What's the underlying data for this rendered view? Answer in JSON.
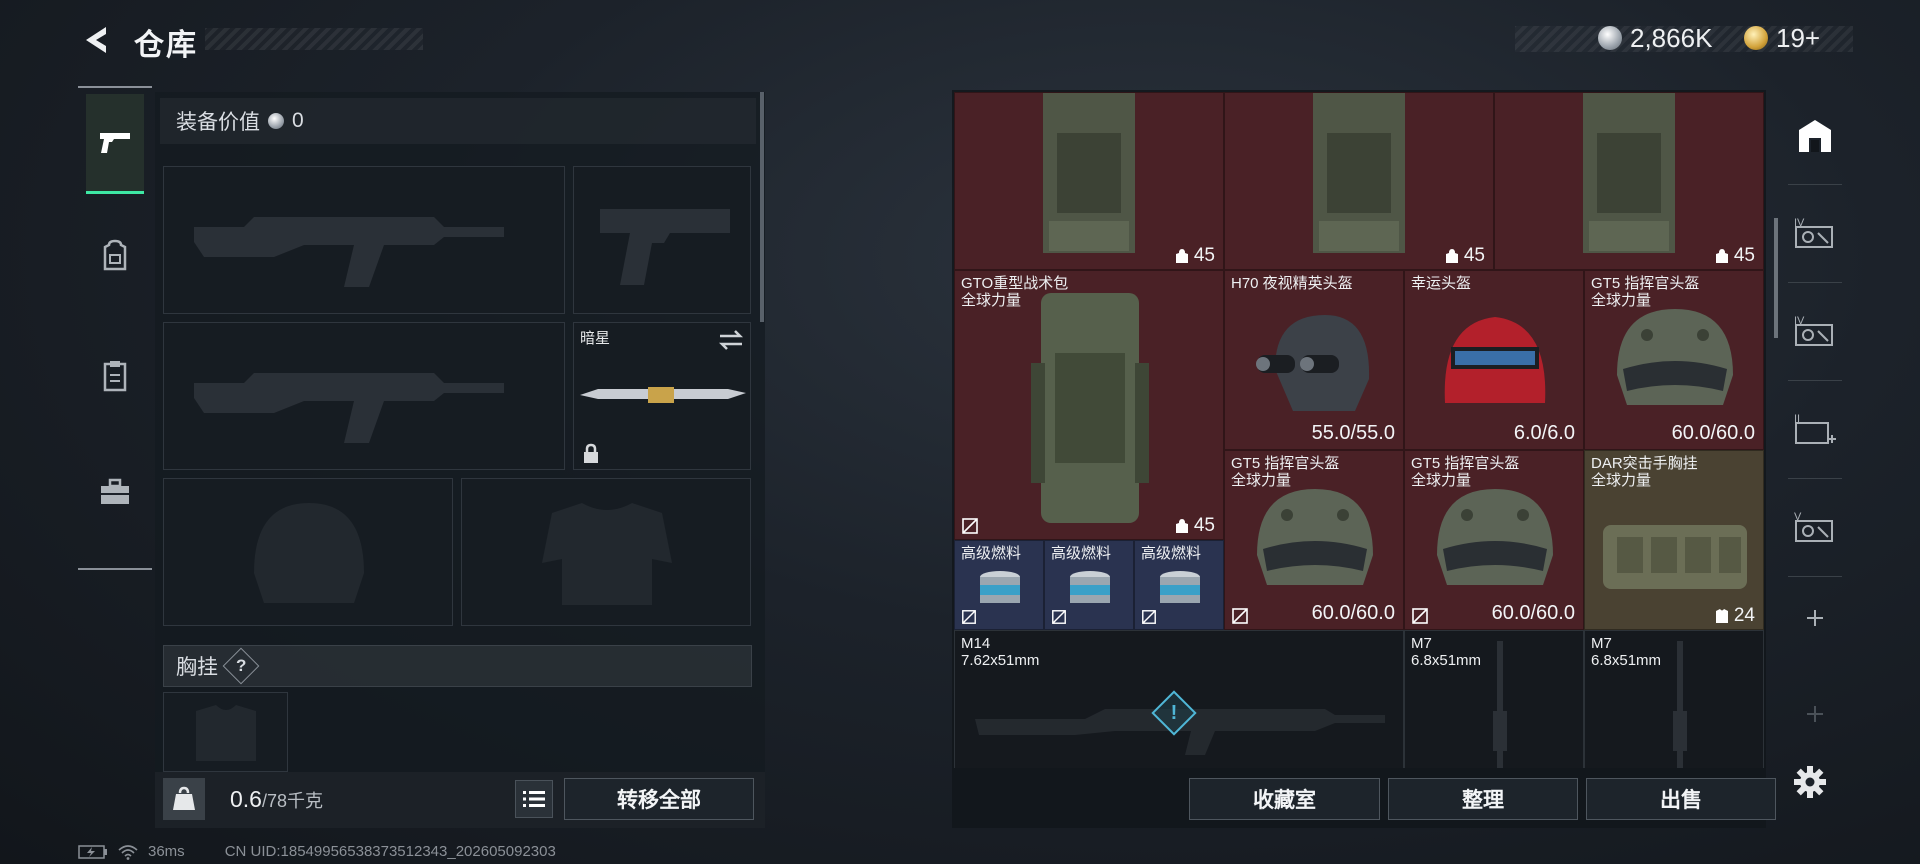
{
  "header": {
    "title": "仓库",
    "currency_silver": "2,866K",
    "currency_gold": "19+"
  },
  "rail": {
    "tabs": [
      {
        "icon": "pistol-icon",
        "active": true
      },
      {
        "icon": "backpack-icon",
        "active": false
      },
      {
        "icon": "clipboard-icon",
        "active": false
      },
      {
        "icon": "toolbox-icon",
        "active": false
      }
    ]
  },
  "loadout": {
    "equip_value_label": "装备价值",
    "equip_value": "0",
    "melee_name": "暗星",
    "chest_section_label": "胸挂",
    "chest_help": "?",
    "weight_current": "0.6",
    "weight_max": "/78千克",
    "transfer_all": "转移全部"
  },
  "stash": {
    "top_row": [
      {
        "value": "45"
      },
      {
        "value": "45"
      },
      {
        "value": "45"
      }
    ],
    "gto": {
      "name": "GTO重型战术包",
      "subtitle": "全球力量",
      "value": "45"
    },
    "fuel": [
      {
        "name": "高级燃料"
      },
      {
        "name": "高级燃料"
      },
      {
        "name": "高级燃料"
      }
    ],
    "helmets": [
      {
        "name": "H70 夜视精英头盔",
        "subtitle": "",
        "durability": "55.0/55.0"
      },
      {
        "name": "幸运头盔",
        "subtitle": "",
        "durability": "6.0/6.0"
      },
      {
        "name": "GT5 指挥官头盔",
        "subtitle": "全球力量",
        "durability": "60.0/60.0"
      },
      {
        "name": "GT5 指挥官头盔",
        "subtitle": "全球力量",
        "durability": "60.0/60.0"
      },
      {
        "name": "GT5 指挥官头盔",
        "subtitle": "全球力量",
        "durability": "60.0/60.0"
      }
    ],
    "rig": {
      "name": "DAR突击手胸挂",
      "subtitle": "全球力量",
      "value": "24"
    },
    "weapons": [
      {
        "name": "M14",
        "caliber": "7.62x51mm"
      },
      {
        "name": "M7",
        "caliber": "6.8x51mm"
      },
      {
        "name": "M7",
        "caliber": "6.8x51mm"
      }
    ],
    "filters": [
      {
        "icon": "home-filter-icon",
        "tier": ""
      },
      {
        "icon": "armor-filter-iv-icon",
        "tier": "IV"
      },
      {
        "icon": "armor-filter-iv-b-icon",
        "tier": "IV"
      },
      {
        "icon": "medkit-filter-icon",
        "tier": "II"
      },
      {
        "icon": "armor-filter-v-icon",
        "tier": "V"
      }
    ],
    "buttons": {
      "collection": "收藏室",
      "organize": "整理",
      "sell": "出售"
    }
  },
  "status": {
    "ping": "36ms",
    "uid": "CN UID:18549956538373512343_202605092303"
  }
}
